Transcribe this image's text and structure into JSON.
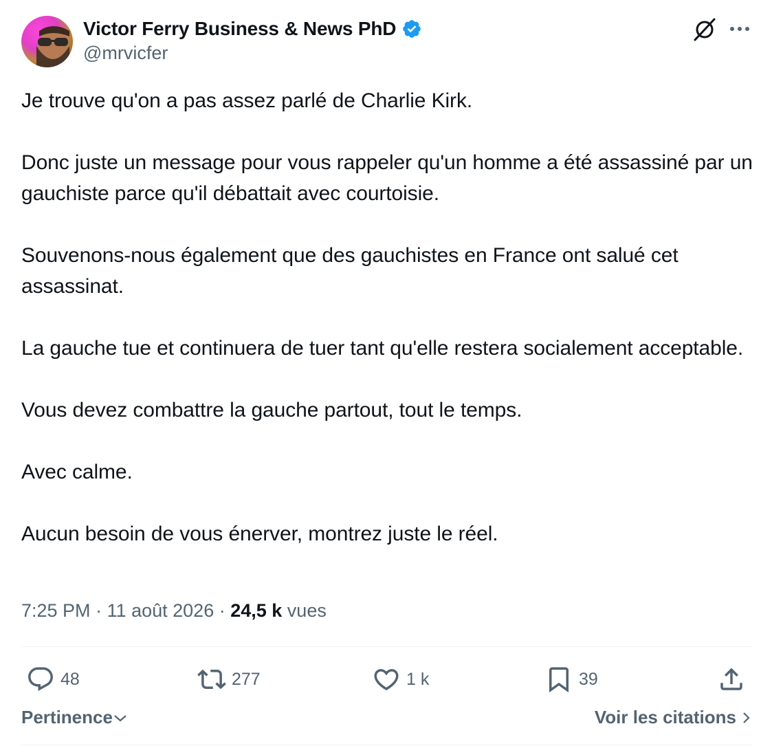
{
  "author": {
    "name": "Victor Ferry Business & News PhD",
    "handle": "@mrvicfer",
    "verified": true,
    "avatar": "avatar-man-sunglasses"
  },
  "header_icons": [
    "grok-icon",
    "more-icon"
  ],
  "tweet": {
    "paragraphs": [
      "Je trouve qu'on a pas assez parlé de Charlie Kirk.",
      "Donc juste un message pour vous rappeler qu'un homme a été assassiné par un gauchiste parce qu'il débattait avec courtoisie.",
      "Souvenons-nous également que des gauchistes en France ont salué cet assassinat.",
      "La gauche tue et continuera de tuer tant qu'elle restera socialement acceptable.",
      "Vous devez combattre la gauche partout, tout le temps.",
      "Avec calme.",
      "Aucun besoin de vous énerver, montrez juste le réel."
    ]
  },
  "meta": {
    "time": "7:25 PM",
    "separator": " · ",
    "date": "11 août 2026",
    "views_count": "24,5 k",
    "views_label": " vues"
  },
  "actions": {
    "reply": {
      "icon": "reply-icon",
      "count": "48"
    },
    "retweet": {
      "icon": "retweet-icon",
      "count": "277"
    },
    "like": {
      "icon": "heart-icon",
      "count": "1 k"
    },
    "bookmark": {
      "icon": "bookmark-icon",
      "count": "39"
    },
    "share": {
      "icon": "share-icon"
    }
  },
  "footer": {
    "sort_label": "Pertinence",
    "quotes_label": "Voir les citations"
  },
  "colors": {
    "text": "#0f1419",
    "secondary": "#536471",
    "verified": "#1d9bf0",
    "divider": "#eff3f4"
  }
}
